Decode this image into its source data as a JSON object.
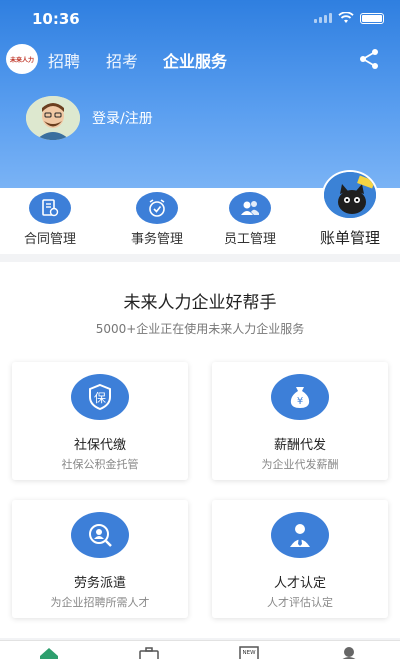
{
  "status": {
    "time": "10:36"
  },
  "logo": {
    "text": "未来人力"
  },
  "nav": {
    "tabs": [
      {
        "label": "招聘"
      },
      {
        "label": "招考"
      },
      {
        "label": "企业服务"
      }
    ]
  },
  "user": {
    "login_label": "登录/注册"
  },
  "menu": {
    "items": [
      {
        "label": "合同管理"
      },
      {
        "label": "事务管理"
      },
      {
        "label": "员工管理"
      },
      {
        "label": "账单管理"
      }
    ]
  },
  "main": {
    "title": "未来人力企业好帮手",
    "subtitle": "5000+企业正在使用未来人力企业服务",
    "services": [
      {
        "title": "社保代缴",
        "desc": "社保公积金托管",
        "icon_text": "保"
      },
      {
        "title": "薪酬代发",
        "desc": "为企业代发薪酬",
        "icon_text": "¥"
      },
      {
        "title": "劳务派遣",
        "desc": "为企业招聘所需人才"
      },
      {
        "title": "人才认定",
        "desc": "人才评估认定"
      }
    ]
  },
  "tabbar": {
    "new_badge": "NEW"
  },
  "colors": {
    "accent": "#3d7fd8",
    "header_top": "#2f7fe0"
  }
}
